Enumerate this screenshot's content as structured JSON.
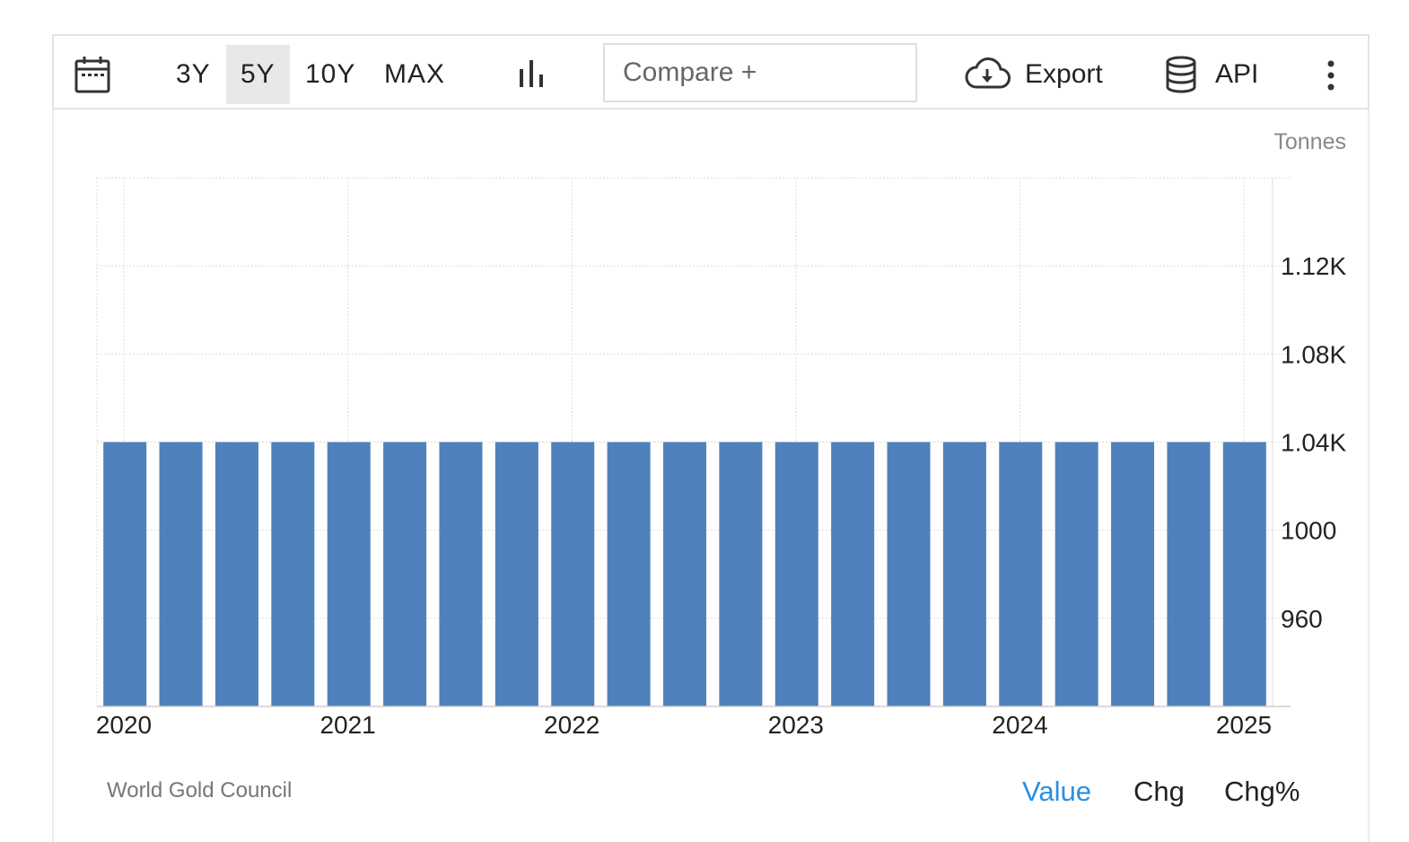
{
  "toolbar": {
    "ranges": [
      {
        "label": "3Y",
        "active": false
      },
      {
        "label": "5Y",
        "active": true
      },
      {
        "label": "10Y",
        "active": false
      },
      {
        "label": "MAX",
        "active": false
      }
    ],
    "compare_label": "Compare +",
    "export_label": "Export",
    "api_label": "API"
  },
  "unit_label": "Tonnes",
  "source": "World Gold Council",
  "tabs": [
    {
      "label": "Value",
      "active": true
    },
    {
      "label": "Chg",
      "active": false
    },
    {
      "label": "Chg%",
      "active": false
    }
  ],
  "colors": {
    "bar": "#4f81bd",
    "active_tab": "#2a8fe0"
  },
  "chart_data": {
    "type": "bar",
    "x_axis_ticks": [
      "2020",
      "2021",
      "2022",
      "2023",
      "2024",
      "2025"
    ],
    "y_axis_ticks": [
      960,
      1000,
      1040,
      1080,
      1120
    ],
    "y_tick_labels": [
      "960",
      "1000",
      "1.04K",
      "1.08K",
      "1.12K"
    ],
    "ylim": [
      920,
      1160
    ],
    "grid": true,
    "series": [
      {
        "values": [
          1040,
          1040,
          1040,
          1040,
          1040,
          1040,
          1040,
          1040,
          1040,
          1040,
          1040,
          1040,
          1040,
          1040,
          1040,
          1040,
          1040,
          1040,
          1040,
          1040,
          1040
        ]
      }
    ]
  }
}
